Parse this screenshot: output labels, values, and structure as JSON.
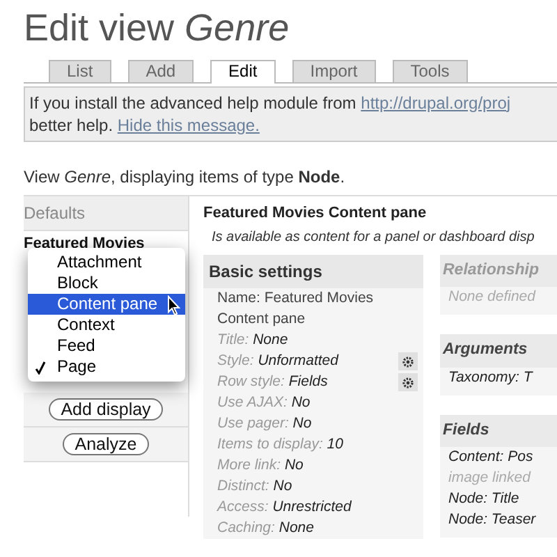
{
  "page_title": {
    "text": "Edit view ",
    "emphasis": "Genre"
  },
  "tabs": [
    {
      "label": "List",
      "selected": false
    },
    {
      "label": "Add",
      "selected": false
    },
    {
      "label": "Edit",
      "selected": true
    },
    {
      "label": "Import",
      "selected": false
    },
    {
      "label": "Tools",
      "selected": false
    }
  ],
  "help_message": {
    "text": "If you install the advanced help module from ",
    "link": "http://drupal.org/proj",
    "text_2": "better help. ",
    "hide_link": "Hide this message."
  },
  "view_summary": "View *Genre*, displaying items of type **Node**.",
  "displays": {
    "header": "Defaults",
    "current": "Featured Movies",
    "add_button": "Add display",
    "analyze_button": "Analyze"
  },
  "display_type_menu": [
    {
      "label": "Attachment",
      "selected": false,
      "checked": false
    },
    {
      "label": "Block",
      "selected": false,
      "checked": false
    },
    {
      "label": "Content pane",
      "selected": true,
      "checked": false
    },
    {
      "label": "Context",
      "selected": false,
      "checked": false
    },
    {
      "label": "Feed",
      "selected": false,
      "checked": false
    },
    {
      "label": "Page",
      "selected": false,
      "checked": true
    }
  ],
  "display_title": "Featured Movies Content pane",
  "display_description": "Is available as content for a panel or dashboard disp",
  "basic_settings": {
    "header": "Basic settings",
    "items": [
      {
        "kind": "name",
        "text": "Name: Featured Movies Content pane",
        "gear": false
      },
      {
        "kind": "setting",
        "label": "Title:",
        "value": "None",
        "gear": false
      },
      {
        "kind": "setting",
        "label": "Style:",
        "value": "Unformatted",
        "gear": true
      },
      {
        "kind": "setting",
        "label": "Row style:",
        "value": "Fields",
        "gear": true
      },
      {
        "kind": "setting",
        "label": "Use AJAX:",
        "value": "No",
        "gear": false
      },
      {
        "kind": "setting",
        "label": "Use pager:",
        "value": "No",
        "gear": false
      },
      {
        "kind": "setting",
        "label": "Items to display:",
        "value": "10",
        "gear": false
      },
      {
        "kind": "setting",
        "label": "More link:",
        "value": "No",
        "gear": false
      },
      {
        "kind": "setting",
        "label": "Distinct:",
        "value": "No",
        "gear": false
      },
      {
        "kind": "setting",
        "label": "Access:",
        "value": "Unrestricted",
        "gear": false
      },
      {
        "kind": "setting",
        "label": "Caching:",
        "value": "None",
        "gear": false
      }
    ]
  },
  "side_sections": [
    {
      "header": "Relationship",
      "empty": true,
      "items": [
        {
          "kind": "muted",
          "text": "None defined"
        }
      ]
    },
    {
      "header": "Arguments",
      "empty": false,
      "items": [
        {
          "kind": "item",
          "text": "Taxonomy: T"
        }
      ]
    },
    {
      "header": "Fields",
      "empty": false,
      "items": [
        {
          "kind": "item",
          "text": "Content: Pos"
        },
        {
          "kind": "muted",
          "text": "image linked"
        },
        {
          "kind": "item",
          "text": "Node: Title"
        },
        {
          "kind": "item",
          "text": "Node: Teaser"
        }
      ]
    }
  ]
}
